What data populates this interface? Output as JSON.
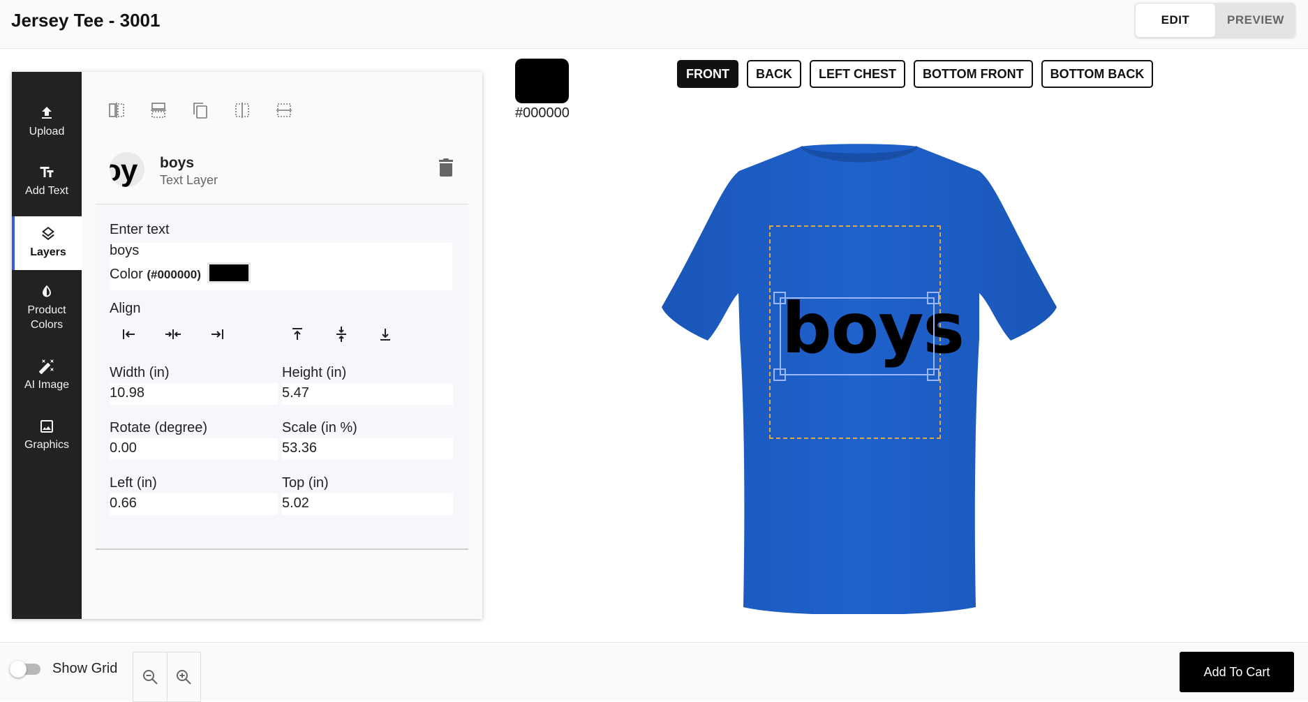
{
  "header": {
    "title": "Jersey Tee - 3001",
    "edit_label": "EDIT",
    "preview_label": "PREVIEW",
    "active_mode": "EDIT"
  },
  "sidebar": {
    "items": [
      {
        "label": "Upload",
        "icon": "upload-icon"
      },
      {
        "label": "Add Text",
        "icon": "text-icon"
      },
      {
        "label": "Layers",
        "icon": "layers-icon",
        "active": true
      },
      {
        "label": "Product Colors",
        "icon": "color-drop-icon"
      },
      {
        "label": "AI Image",
        "icon": "magic-wand-icon"
      },
      {
        "label": "Graphics",
        "icon": "image-icon"
      }
    ]
  },
  "toolbar": {
    "tools": [
      "flip-horizontal-icon",
      "flip-vertical-icon",
      "duplicate-icon",
      "center-vertical-icon",
      "center-horizontal-icon"
    ]
  },
  "layer": {
    "thumb_text": "oy",
    "name": "boys",
    "type": "Text Layer",
    "enter_text_label": "Enter text",
    "text_value": "boys",
    "color_label": "Color",
    "color_hex_label": "(#000000)",
    "color": "#000000",
    "align_label": "Align",
    "align_icons": [
      "align-left-icon",
      "align-center-horizontal-icon",
      "align-right-icon",
      "align-top-icon",
      "align-middle-icon",
      "align-bottom-icon"
    ],
    "width_label": "Width (in)",
    "width_value": "10.98",
    "height_label": "Height (in)",
    "height_value": "5.47",
    "rotate_label": "Rotate (degree)",
    "rotate_value": "0.00",
    "scale_label": "Scale (in %)",
    "scale_value": "53.36",
    "left_label": "Left (in)",
    "left_value": "0.66",
    "top_label": "Top (in)",
    "top_value": "5.02"
  },
  "canvas": {
    "product_color": "#000000",
    "product_color_label": "#000000",
    "views": [
      "FRONT",
      "BACK",
      "LEFT CHEST",
      "BOTTOM FRONT",
      "BOTTOM BACK"
    ],
    "active_view": "FRONT",
    "shirt_color": "#1f5fc4",
    "design_text": "boys",
    "print_area_color": "#e0a640",
    "selection_color": "#9ab8ff"
  },
  "footer": {
    "show_grid_label": "Show Grid",
    "show_grid": false,
    "add_to_cart_label": "Add To Cart"
  }
}
